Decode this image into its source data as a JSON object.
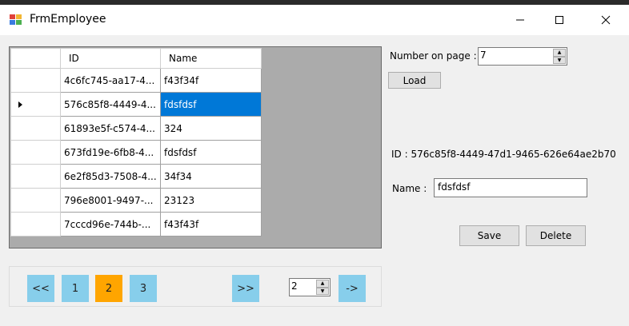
{
  "window": {
    "title": "FrmEmployee",
    "minimize_glyph": "—",
    "maximize_glyph": "☐",
    "close_glyph": "✕"
  },
  "grid": {
    "columns": [
      "ID",
      "Name"
    ],
    "rows": [
      {
        "id": "4c6fc745-aa17-4...",
        "name": "f43f34f"
      },
      {
        "id": "576c85f8-4449-4...",
        "name": "fdsfdsf"
      },
      {
        "id": "61893e5f-c574-4...",
        "name": "324"
      },
      {
        "id": "673fd19e-6fb8-4...",
        "name": "fdsfdsf"
      },
      {
        "id": "6e2f85d3-7508-4...",
        "name": "34f34"
      },
      {
        "id": "796e8001-9497-...",
        "name": "23123"
      },
      {
        "id": "7cccd96e-744b-...",
        "name": "f43f43f"
      }
    ],
    "selected_row_index": 1
  },
  "controls": {
    "number_on_page_label": "Number on page  :",
    "number_on_page_value": "7",
    "load_label": "Load",
    "id_text": "ID : 576c85f8-4449-47d1-9465-626e64ae2b70",
    "name_label": "Name :",
    "name_value": "fdsfdsf",
    "save_label": "Save",
    "delete_label": "Delete"
  },
  "pager": {
    "first_label": "<<",
    "pages": [
      "1",
      "2",
      "3"
    ],
    "current_page": "2",
    "last_label": ">>",
    "goto_value": "2",
    "go_label": "->"
  },
  "colors": {
    "page_button": "#87ceeb",
    "active_page_button": "#ffa500",
    "selection": "#0078d7"
  },
  "icons": {
    "app": "app-icon",
    "spin_up": "spin-up-icon",
    "spin_down": "spin-down-icon",
    "row_indicator": "row-indicator-icon"
  }
}
